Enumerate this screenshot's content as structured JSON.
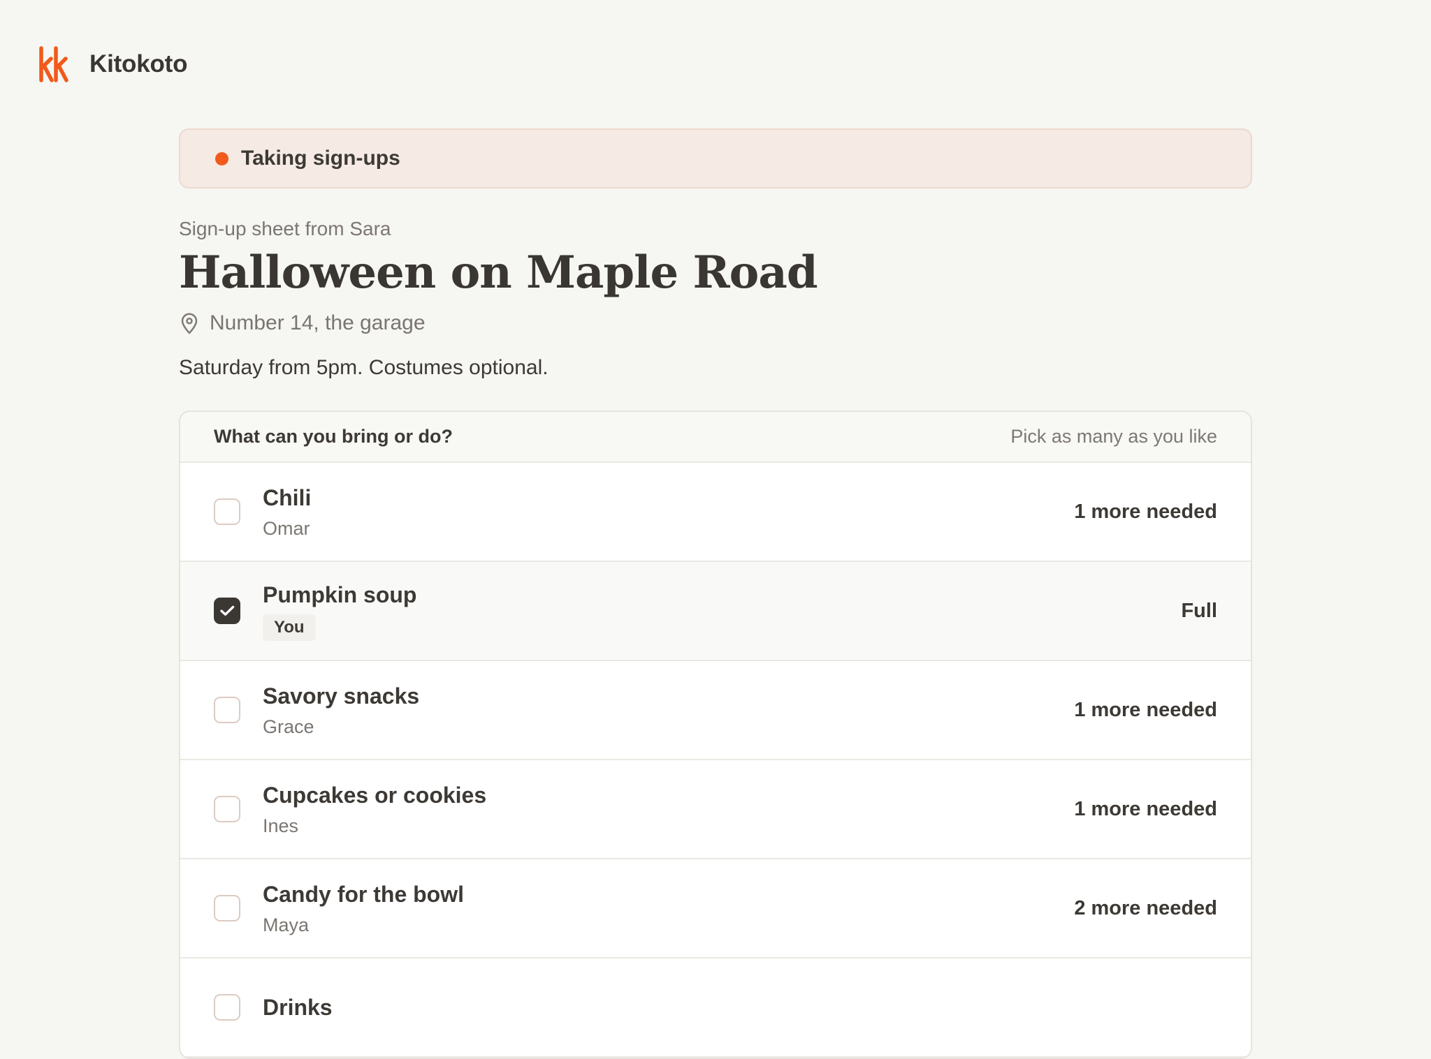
{
  "brand": {
    "name": "Kitokoto",
    "logo_icon": "kk-logo-icon",
    "accent_color": "#f15a1a"
  },
  "status": {
    "label": "Taking sign-ups",
    "dot_color": "#f15a1a"
  },
  "event": {
    "from": "Sign-up sheet from Sara",
    "title": "Halloween on Maple Road",
    "location": "Number 14, the garage",
    "description": "Saturday from 5pm. Costumes optional."
  },
  "signup_list": {
    "header_title": "What can you bring or do?",
    "header_hint": "Pick as many as you like",
    "items": [
      {
        "name": "Chili",
        "person": "Omar",
        "need": "1 more needed",
        "checked": false
      },
      {
        "name": "Pumpkin soup",
        "badge": "You",
        "need": "Full",
        "checked": true
      },
      {
        "name": "Savory snacks",
        "person": "Grace",
        "need": "1 more needed",
        "checked": false
      },
      {
        "name": "Cupcakes or cookies",
        "person": "Ines",
        "need": "1 more needed",
        "checked": false
      },
      {
        "name": "Candy for the bowl",
        "person": "Maya",
        "need": "2 more needed",
        "checked": false
      },
      {
        "name": "Drinks",
        "checked": false
      }
    ]
  }
}
